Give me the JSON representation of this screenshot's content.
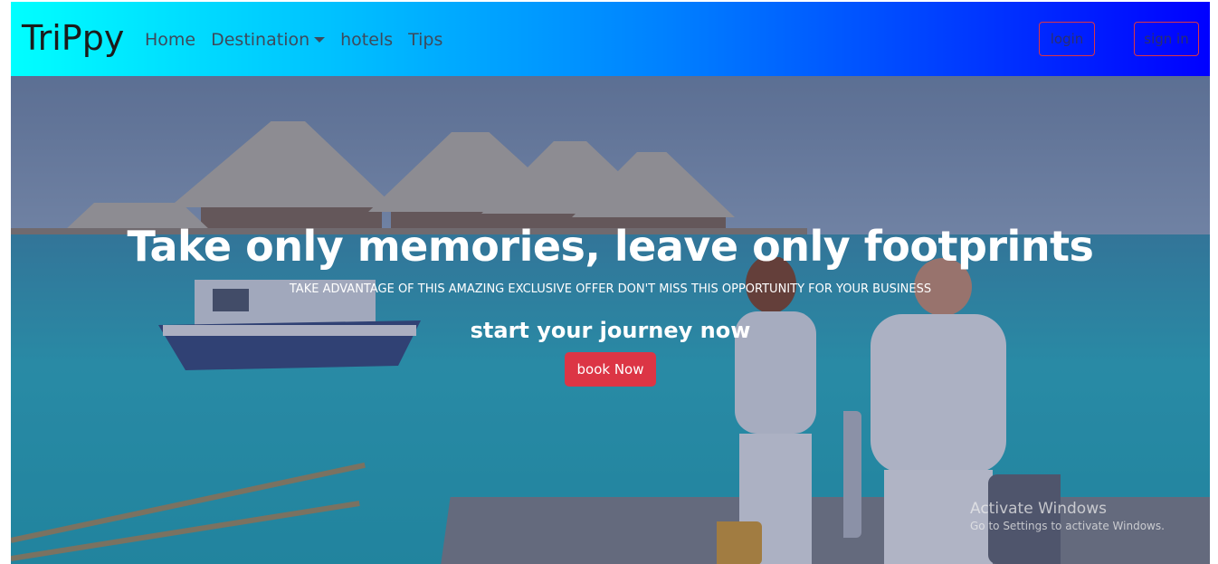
{
  "navbar": {
    "brand": "TriPpy",
    "links": [
      {
        "label": "Home"
      },
      {
        "label": "Destination",
        "has_dropdown": true
      },
      {
        "label": "hotels"
      },
      {
        "label": "Tips"
      }
    ],
    "login_label": "login",
    "signin_label": "sign in",
    "gradient_colors": [
      "#00ffff",
      "#0000ff"
    ]
  },
  "hero": {
    "title": "Take only memories, leave only footprints",
    "subtitle": "TAKE ADVANTAGE OF THIS AMAZING EXCLUSIVE OFFER DON'T MISS THIS OPPORTUNITY FOR YOUR BUSINESS",
    "cta_text": "start your journey now",
    "book_label": "book Now",
    "book_color": "#dc3545"
  },
  "watermark": {
    "title": "Activate Windows",
    "subtitle": "Go to Settings to activate Windows."
  }
}
